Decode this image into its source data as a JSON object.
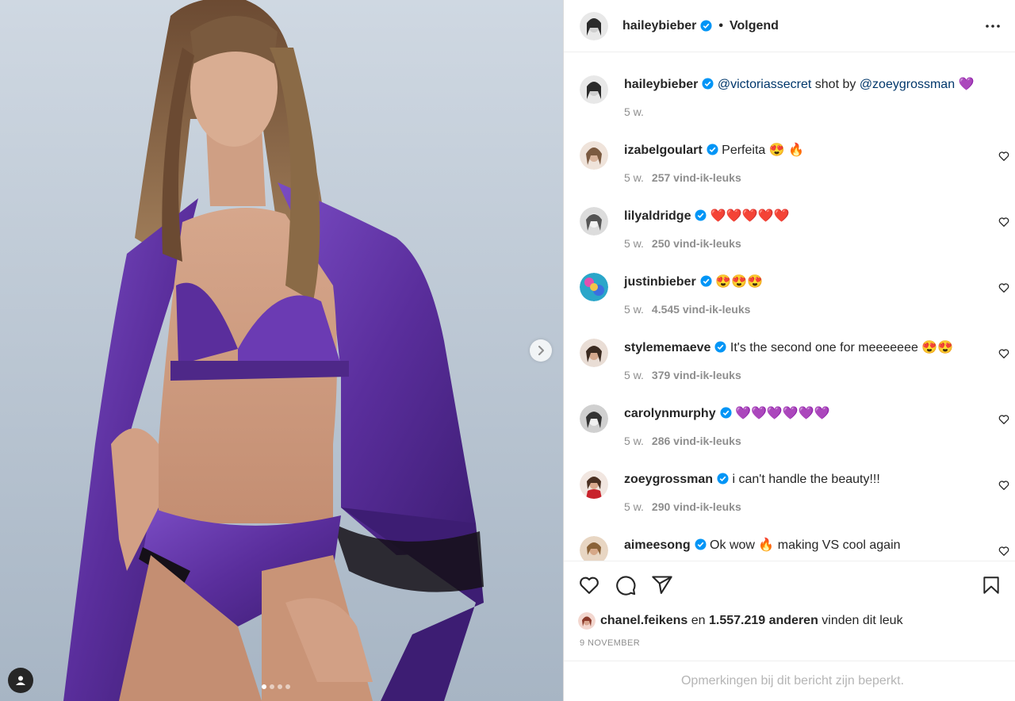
{
  "post": {
    "username": "haileybieber",
    "follow_status": "Volgend",
    "separator": "•"
  },
  "caption": {
    "username": "haileybieber",
    "mention1": "@victoriassecret",
    "middle_text": " shot by ",
    "mention2": "@zoeygrossman",
    "emoji": "💜",
    "time": "5 w."
  },
  "comments": [
    {
      "username": "izabelgoulart",
      "text": "Perfeita 😍 🔥",
      "time": "5 w.",
      "likes": "257 vind-ik-leuks"
    },
    {
      "username": "lilyaldridge",
      "text": "❤️❤️❤️❤️❤️",
      "time": "5 w.",
      "likes": "250 vind-ik-leuks"
    },
    {
      "username": "justinbieber",
      "text": "😍😍😍",
      "time": "5 w.",
      "likes": "4.545 vind-ik-leuks"
    },
    {
      "username": "stylememaeve",
      "text": "It's the second one for meeeeeee 😍😍",
      "time": "5 w.",
      "likes": "379 vind-ik-leuks"
    },
    {
      "username": "carolynmurphy",
      "text": "💜💜💜💜💜💜",
      "time": "5 w.",
      "likes": "286 vind-ik-leuks"
    },
    {
      "username": "zoeygrossman",
      "text": "i can't handle the beauty!!!",
      "time": "5 w.",
      "likes": "290 vind-ik-leuks"
    },
    {
      "username": "aimeesong",
      "text": "Ok wow 🔥 making VS cool again",
      "time": "",
      "likes": ""
    }
  ],
  "likes_line": {
    "liker": "chanel.feikens",
    "and": " en ",
    "count": "1.557.219 anderen",
    "suffix": " vinden dit leuk"
  },
  "date": "9 NOVEMBER",
  "restricted_text": "Opmerkingen bij dit bericht zijn beperkt.",
  "icons": [
    "verified-badge-icon",
    "more-options-icon",
    "like-icon",
    "comment-icon",
    "share-icon",
    "save-icon",
    "chevron-right-icon",
    "user-tag-icon"
  ],
  "colors": {
    "accent_blue": "#0095f6",
    "mention": "#00376b",
    "robe_purple": "#5b2f9e",
    "muted": "#8e8e8e"
  }
}
